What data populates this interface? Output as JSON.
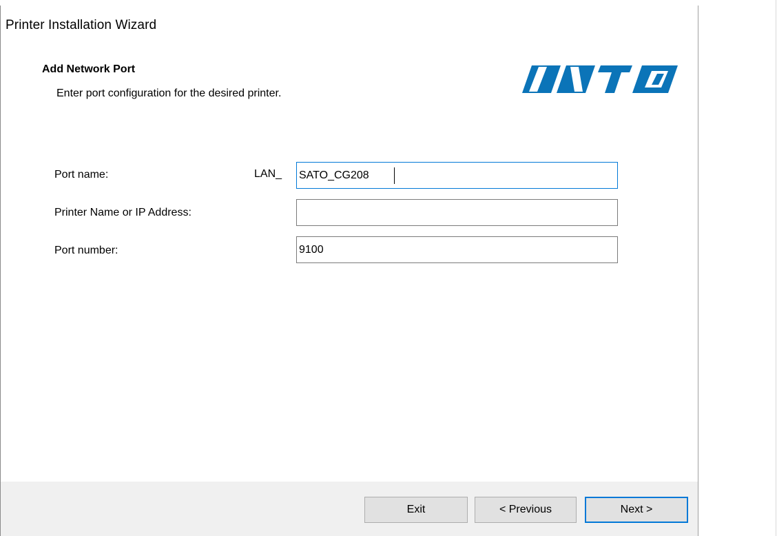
{
  "window": {
    "title": "Printer Installation Wizard"
  },
  "header": {
    "title": "Add Network Port",
    "subtitle": "Enter port configuration for the desired printer.",
    "logo_text": "SATO",
    "logo_color": "#0b74b8"
  },
  "form": {
    "port_name": {
      "label": "Port name:",
      "prefix": "LAN_",
      "value": "SATO_CG208"
    },
    "printer_address": {
      "label": "Printer Name or IP Address:",
      "value": ""
    },
    "port_number": {
      "label": "Port number:",
      "value": "9100"
    }
  },
  "buttons": {
    "exit": "Exit",
    "previous": "< Previous",
    "next": "Next >"
  },
  "colors": {
    "focus": "#0078d7",
    "footer_bg": "#f0f0f0",
    "button_bg": "#e1e1e1"
  }
}
